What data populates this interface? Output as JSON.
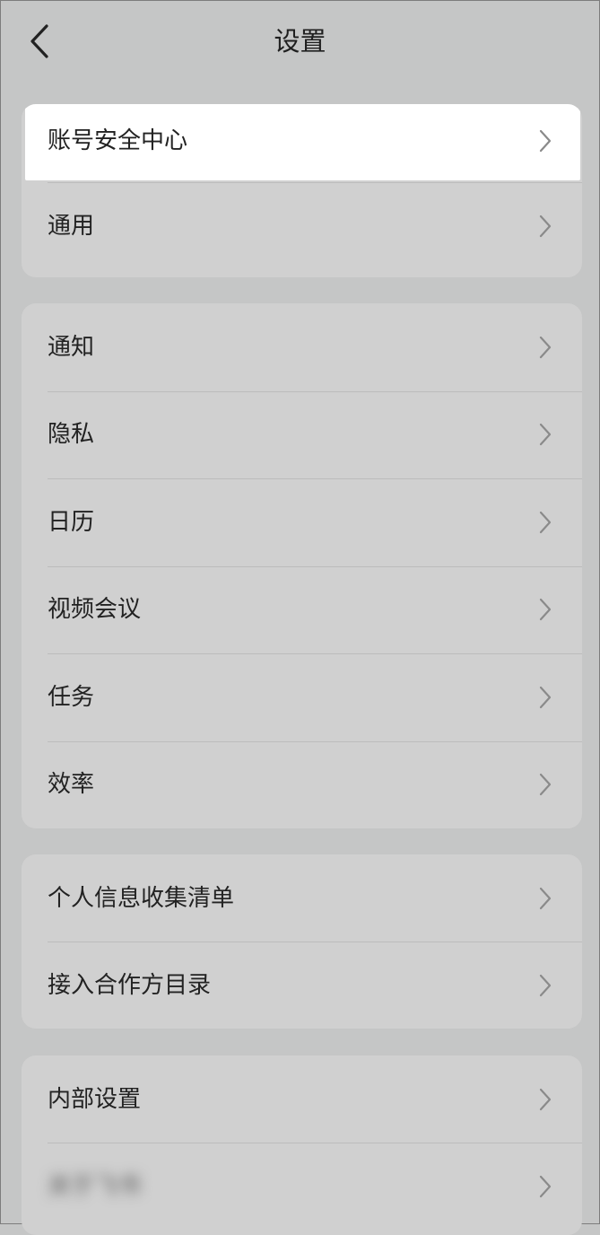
{
  "header": {
    "title": "设置"
  },
  "groups": [
    {
      "items": [
        {
          "label": "账号安全中心"
        },
        {
          "label": "通用"
        }
      ]
    },
    {
      "items": [
        {
          "label": "通知"
        },
        {
          "label": "隐私"
        },
        {
          "label": "日历"
        },
        {
          "label": "视频会议"
        },
        {
          "label": "任务"
        },
        {
          "label": "效率"
        }
      ]
    },
    {
      "items": [
        {
          "label": "个人信息收集清单"
        },
        {
          "label": "接入合作方目录"
        }
      ]
    },
    {
      "items": [
        {
          "label": "内部设置"
        },
        {
          "label": "关于飞书"
        }
      ]
    }
  ],
  "icons": {
    "back": "chevron-left-icon",
    "row_arrow": "chevron-right-icon"
  },
  "colors": {
    "background": "#c5c6c6",
    "card": "#d0d0d0",
    "highlight": "#ffffff",
    "text": "#222222",
    "chevron": "#8a8a8a"
  }
}
